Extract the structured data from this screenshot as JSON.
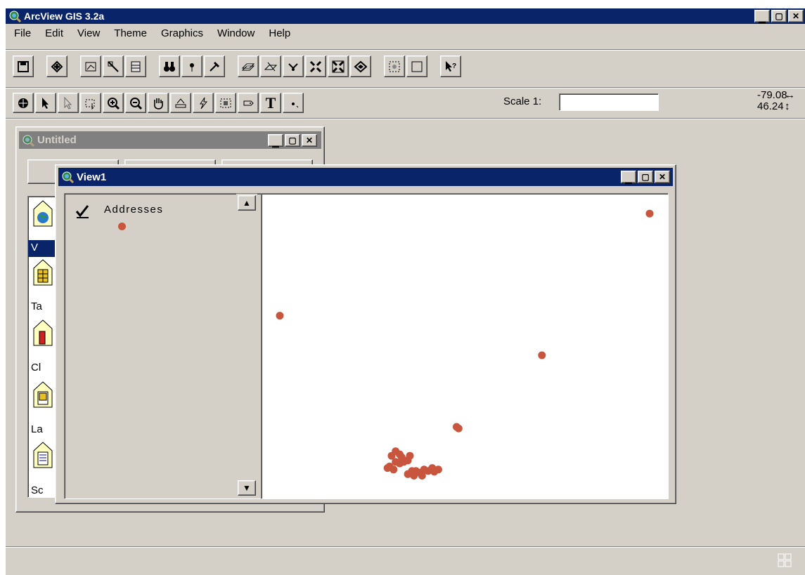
{
  "app": {
    "title": "ArcView GIS 3.2a",
    "minimize": "_",
    "maximize": "□",
    "close": "×"
  },
  "menu": [
    "File",
    "Edit",
    "View",
    "Theme",
    "Graphics",
    "Window",
    "Help"
  ],
  "toolbar": {
    "scale_label": "Scale 1:",
    "scale_value": "",
    "coord_x": "-79.08",
    "coord_y": "46.24",
    "text_tool": "T"
  },
  "project_window": {
    "title": "Untitled",
    "doc_types": [
      "V",
      "Ta",
      "Cl",
      "La",
      "Sc"
    ]
  },
  "view_window": {
    "title": "View1",
    "layer": {
      "name": "Addresses",
      "visible": true,
      "symbol_color": "#c8553d"
    }
  },
  "colors": {
    "accent_titlebar": "#0a246a",
    "point": "#c8553d",
    "face": "#d4d0c8"
  },
  "map_points": [
    {
      "lon": 0.955,
      "lat": 0.935
    },
    {
      "lon": 0.045,
      "lat": 0.6
    },
    {
      "lon": 0.69,
      "lat": 0.47
    },
    {
      "lon": 0.485,
      "lat": 0.23
    },
    {
      "lon": 0.48,
      "lat": 0.235
    },
    {
      "lon": 0.33,
      "lat": 0.12
    },
    {
      "lon": 0.34,
      "lat": 0.115
    },
    {
      "lon": 0.345,
      "lat": 0.135
    },
    {
      "lon": 0.315,
      "lat": 0.105
    },
    {
      "lon": 0.31,
      "lat": 0.1
    },
    {
      "lon": 0.325,
      "lat": 0.095
    },
    {
      "lon": 0.35,
      "lat": 0.12
    },
    {
      "lon": 0.36,
      "lat": 0.125
    },
    {
      "lon": 0.365,
      "lat": 0.14
    },
    {
      "lon": 0.34,
      "lat": 0.145
    },
    {
      "lon": 0.32,
      "lat": 0.14
    },
    {
      "lon": 0.33,
      "lat": 0.155
    },
    {
      "lon": 0.38,
      "lat": 0.09
    },
    {
      "lon": 0.375,
      "lat": 0.075
    },
    {
      "lon": 0.36,
      "lat": 0.08
    },
    {
      "lon": 0.39,
      "lat": 0.085
    },
    {
      "lon": 0.4,
      "lat": 0.095
    },
    {
      "lon": 0.41,
      "lat": 0.09
    },
    {
      "lon": 0.42,
      "lat": 0.1
    },
    {
      "lon": 0.435,
      "lat": 0.095
    },
    {
      "lon": 0.425,
      "lat": 0.088
    },
    {
      "lon": 0.395,
      "lat": 0.075
    },
    {
      "lon": 0.37,
      "lat": 0.09
    }
  ]
}
